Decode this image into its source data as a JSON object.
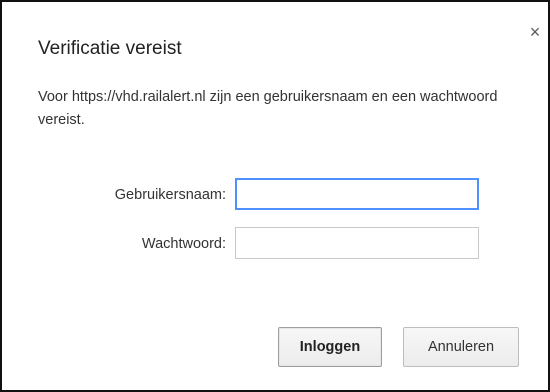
{
  "dialog": {
    "title": "Verificatie vereist",
    "description": "Voor https://vhd.railalert.nl zijn een gebruikersnaam en een wachtwoord vereist.",
    "close_icon": "close-icon",
    "close_glyph": "×"
  },
  "form": {
    "username_label": "Gebruikersnaam:",
    "username_value": "",
    "password_label": "Wachtwoord:",
    "password_value": ""
  },
  "buttons": {
    "login_label": "Inloggen",
    "cancel_label": "Annuleren"
  },
  "colors": {
    "focus_border": "#4d90fe",
    "dialog_border": "#111111"
  }
}
